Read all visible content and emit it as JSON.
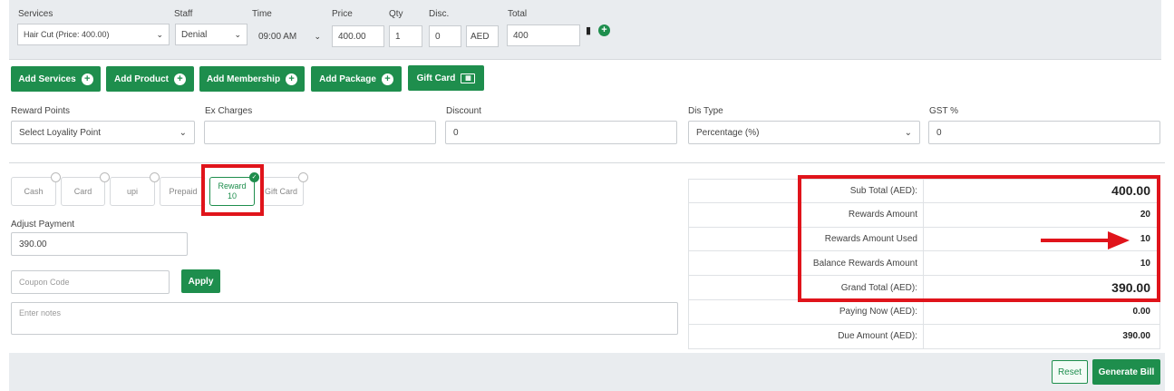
{
  "service_row": {
    "labels": {
      "services": "Services",
      "staff": "Staff",
      "time": "Time",
      "price": "Price",
      "qty": "Qty",
      "disc": "Disc.",
      "total": "Total"
    },
    "service_value": "Hair Cut (Price: 400.00)",
    "staff_value": "Denial",
    "time_value": "09:00 AM",
    "price_value": "400.00",
    "qty_value": "1",
    "disc_value": "0",
    "currency_value": "AED",
    "total_value": "400"
  },
  "add_buttons": {
    "services": "Add Services",
    "product": "Add Product",
    "membership": "Add Membership",
    "package": "Add Package",
    "gift_card": "Gift Card"
  },
  "options_row": {
    "reward_points_label": "Reward Points",
    "reward_points_value": "Select Loyality Point",
    "ex_charges_label": "Ex Charges",
    "ex_charges_value": "",
    "discount_label": "Discount",
    "discount_value": "0",
    "dis_type_label": "Dis Type",
    "dis_type_value": "Percentage (%)",
    "gst_label": "GST %",
    "gst_value": "0"
  },
  "payment_methods": {
    "cash": "Cash",
    "card": "Card",
    "upi": "upi",
    "prepaid": "Prepaid",
    "reward_line1": "Reward",
    "reward_line2": "10",
    "gift_card": "Gift Card"
  },
  "adjust_payment": {
    "label": "Adjust Payment",
    "value": "390.00"
  },
  "coupon": {
    "placeholder": "Coupon Code",
    "apply": "Apply"
  },
  "notes": {
    "placeholder": "Enter notes"
  },
  "summary": {
    "rows": [
      {
        "label": "Sub Total (AED):",
        "value": "400.00"
      },
      {
        "label": "Rewards Amount",
        "value": "20"
      },
      {
        "label": "Rewards Amount Used",
        "value": "10"
      },
      {
        "label": "Balance Rewards Amount",
        "value": "10"
      },
      {
        "label": "Grand Total (AED):",
        "value": "390.00"
      },
      {
        "label": "Paying Now (AED):",
        "value": "0.00"
      },
      {
        "label": "Due Amount (AED):",
        "value": "390.00"
      }
    ]
  },
  "footer": {
    "reset": "Reset",
    "generate": "Generate Bill"
  },
  "colors": {
    "accent": "#1e8e4d",
    "highlight": "#e0141b"
  },
  "icons": [
    "trash-icon",
    "plus-circle-icon",
    "chevron-down-icon",
    "check-icon",
    "arrow-right-icon",
    "card-icon"
  ]
}
